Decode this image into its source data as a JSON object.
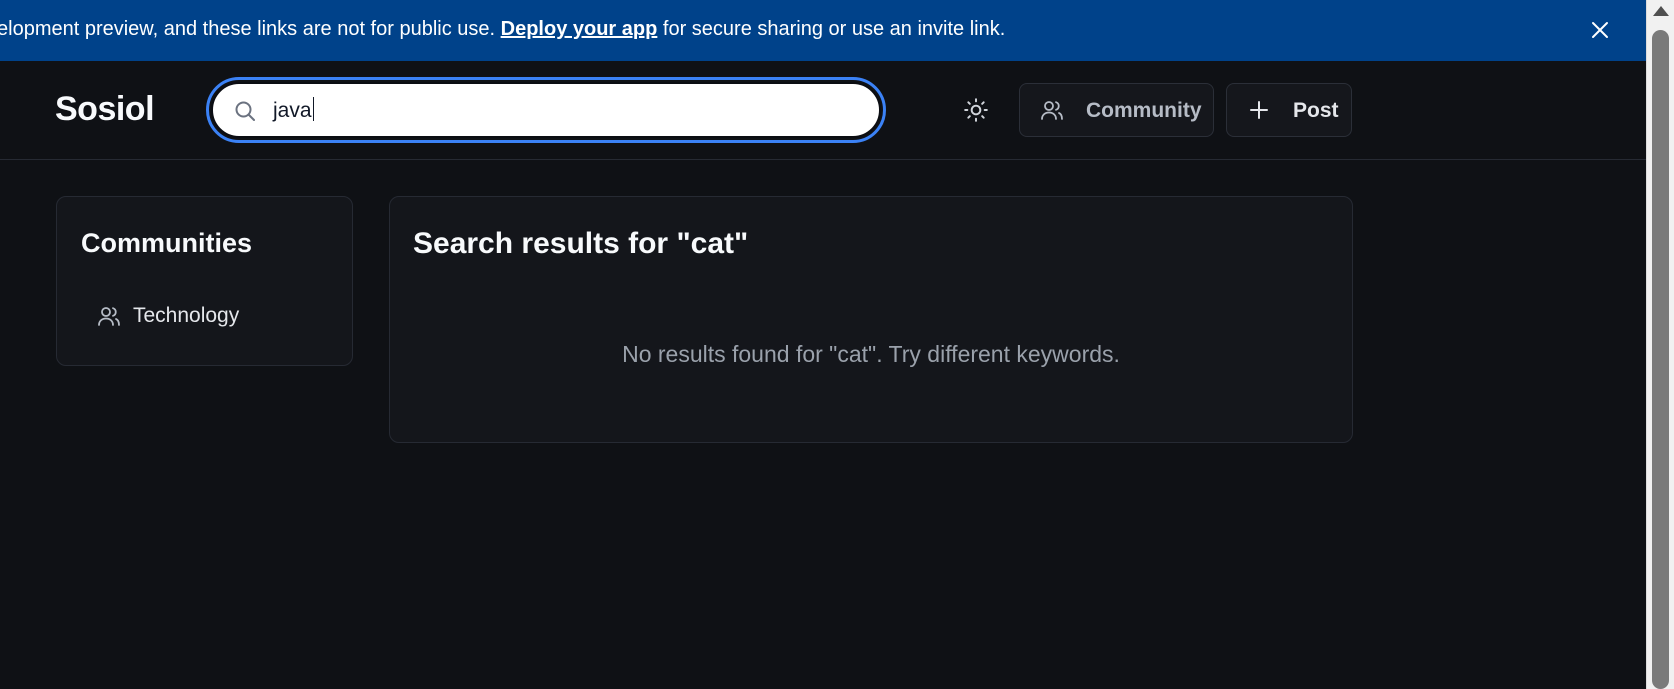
{
  "banner": {
    "text_before": "elopment preview, and these links are not for public use.",
    "link_label": "Deploy your app",
    "text_after": "for secure sharing or use an invite link.",
    "close_icon": "close-icon"
  },
  "header": {
    "logo": "Sosiol",
    "search": {
      "value": "java",
      "icon": "search-icon"
    },
    "theme_icon": "sun-icon",
    "community_button": {
      "label": "Community",
      "icon": "users-icon"
    },
    "post_button": {
      "label": "Post",
      "icon": "plus-icon"
    }
  },
  "sidebar": {
    "title": "Communities",
    "items": [
      {
        "label": "Technology",
        "icon": "users-icon"
      }
    ]
  },
  "main": {
    "title": "Search results for \"cat\"",
    "empty_message": "No results found for \"cat\". Try different keywords."
  },
  "colors": {
    "banner_bg": "#00428a",
    "page_bg": "#0f1115",
    "card_bg": "#14161b",
    "focus_ring": "#3b82f6"
  }
}
